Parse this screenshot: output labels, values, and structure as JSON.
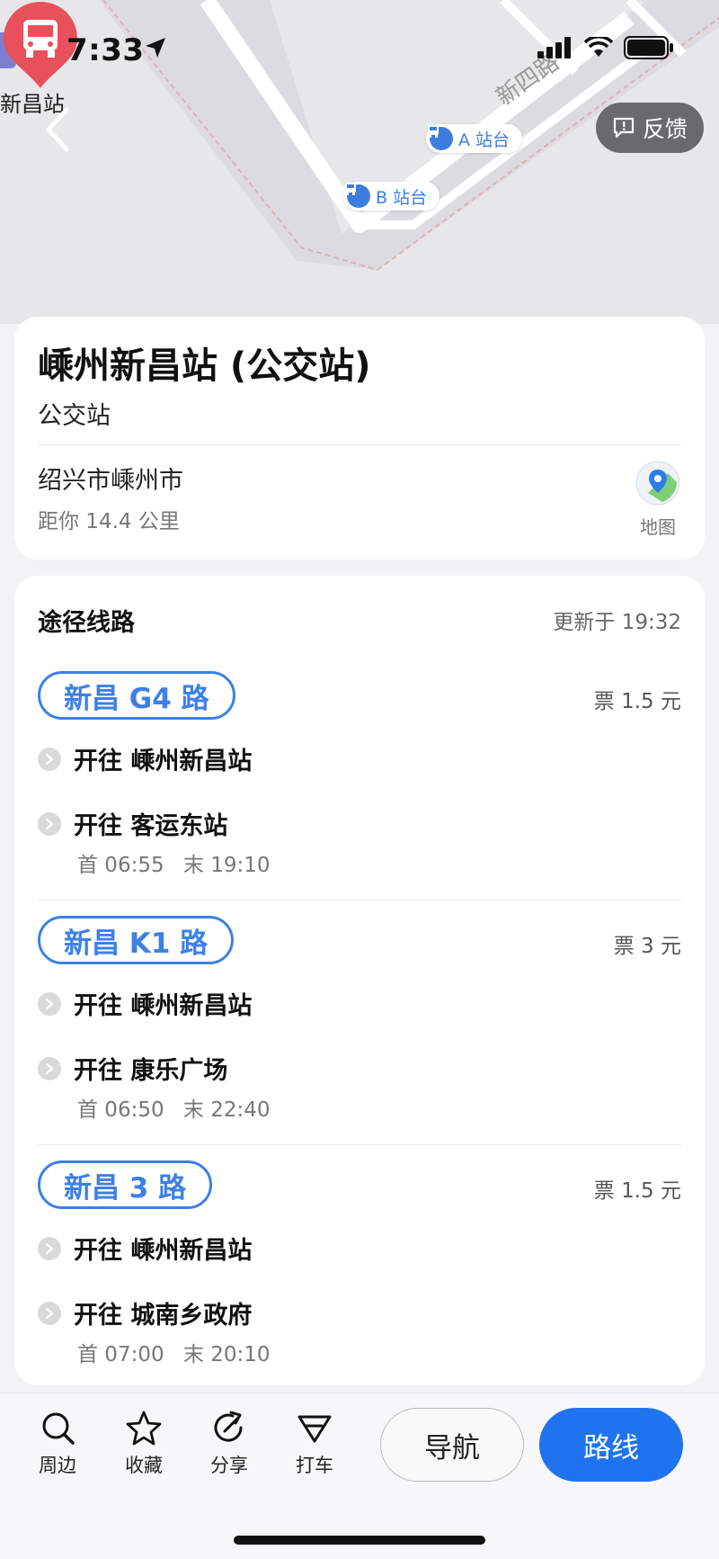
{
  "status": {
    "time": "7:33"
  },
  "map": {
    "left_station_label": "新昌站",
    "road_label": "新四路",
    "platform_a": "A 站台",
    "platform_b": "B 站台",
    "feedback_label": "反馈"
  },
  "stop": {
    "name": "嵊州新昌站 (公交站)",
    "type": "公交站",
    "city": "绍兴市嵊州市",
    "distance": "距你 14.4 公里",
    "map_button_label": "地图"
  },
  "routes_section": {
    "title": "途径线路",
    "updated": "更新于 19:32",
    "routes": [
      {
        "name": "新昌 G4 路",
        "fare": "票 1.5 元",
        "directions": [
          {
            "text": "开往 嵊州新昌站"
          },
          {
            "text": "开往 客运东站",
            "first": "首 06:55",
            "last": "末 19:10"
          }
        ]
      },
      {
        "name": "新昌 K1 路",
        "fare": "票 3 元",
        "directions": [
          {
            "text": "开往 嵊州新昌站"
          },
          {
            "text": "开往 康乐广场",
            "first": "首 06:50",
            "last": "末 22:40"
          }
        ]
      },
      {
        "name": "新昌 3 路",
        "fare": "票 1.5 元",
        "directions": [
          {
            "text": "开往 嵊州新昌站"
          },
          {
            "text": "开往 城南乡政府",
            "first": "首 07:00",
            "last": "末 20:10"
          }
        ]
      }
    ]
  },
  "toolbar": {
    "nearby": "周边",
    "favorite": "收藏",
    "share": "分享",
    "taxi": "打车",
    "navigate": "导航",
    "route": "路线"
  },
  "colors": {
    "accent": "#1f73ee",
    "chip": "#3d80e6",
    "pin": "#e8505b"
  }
}
